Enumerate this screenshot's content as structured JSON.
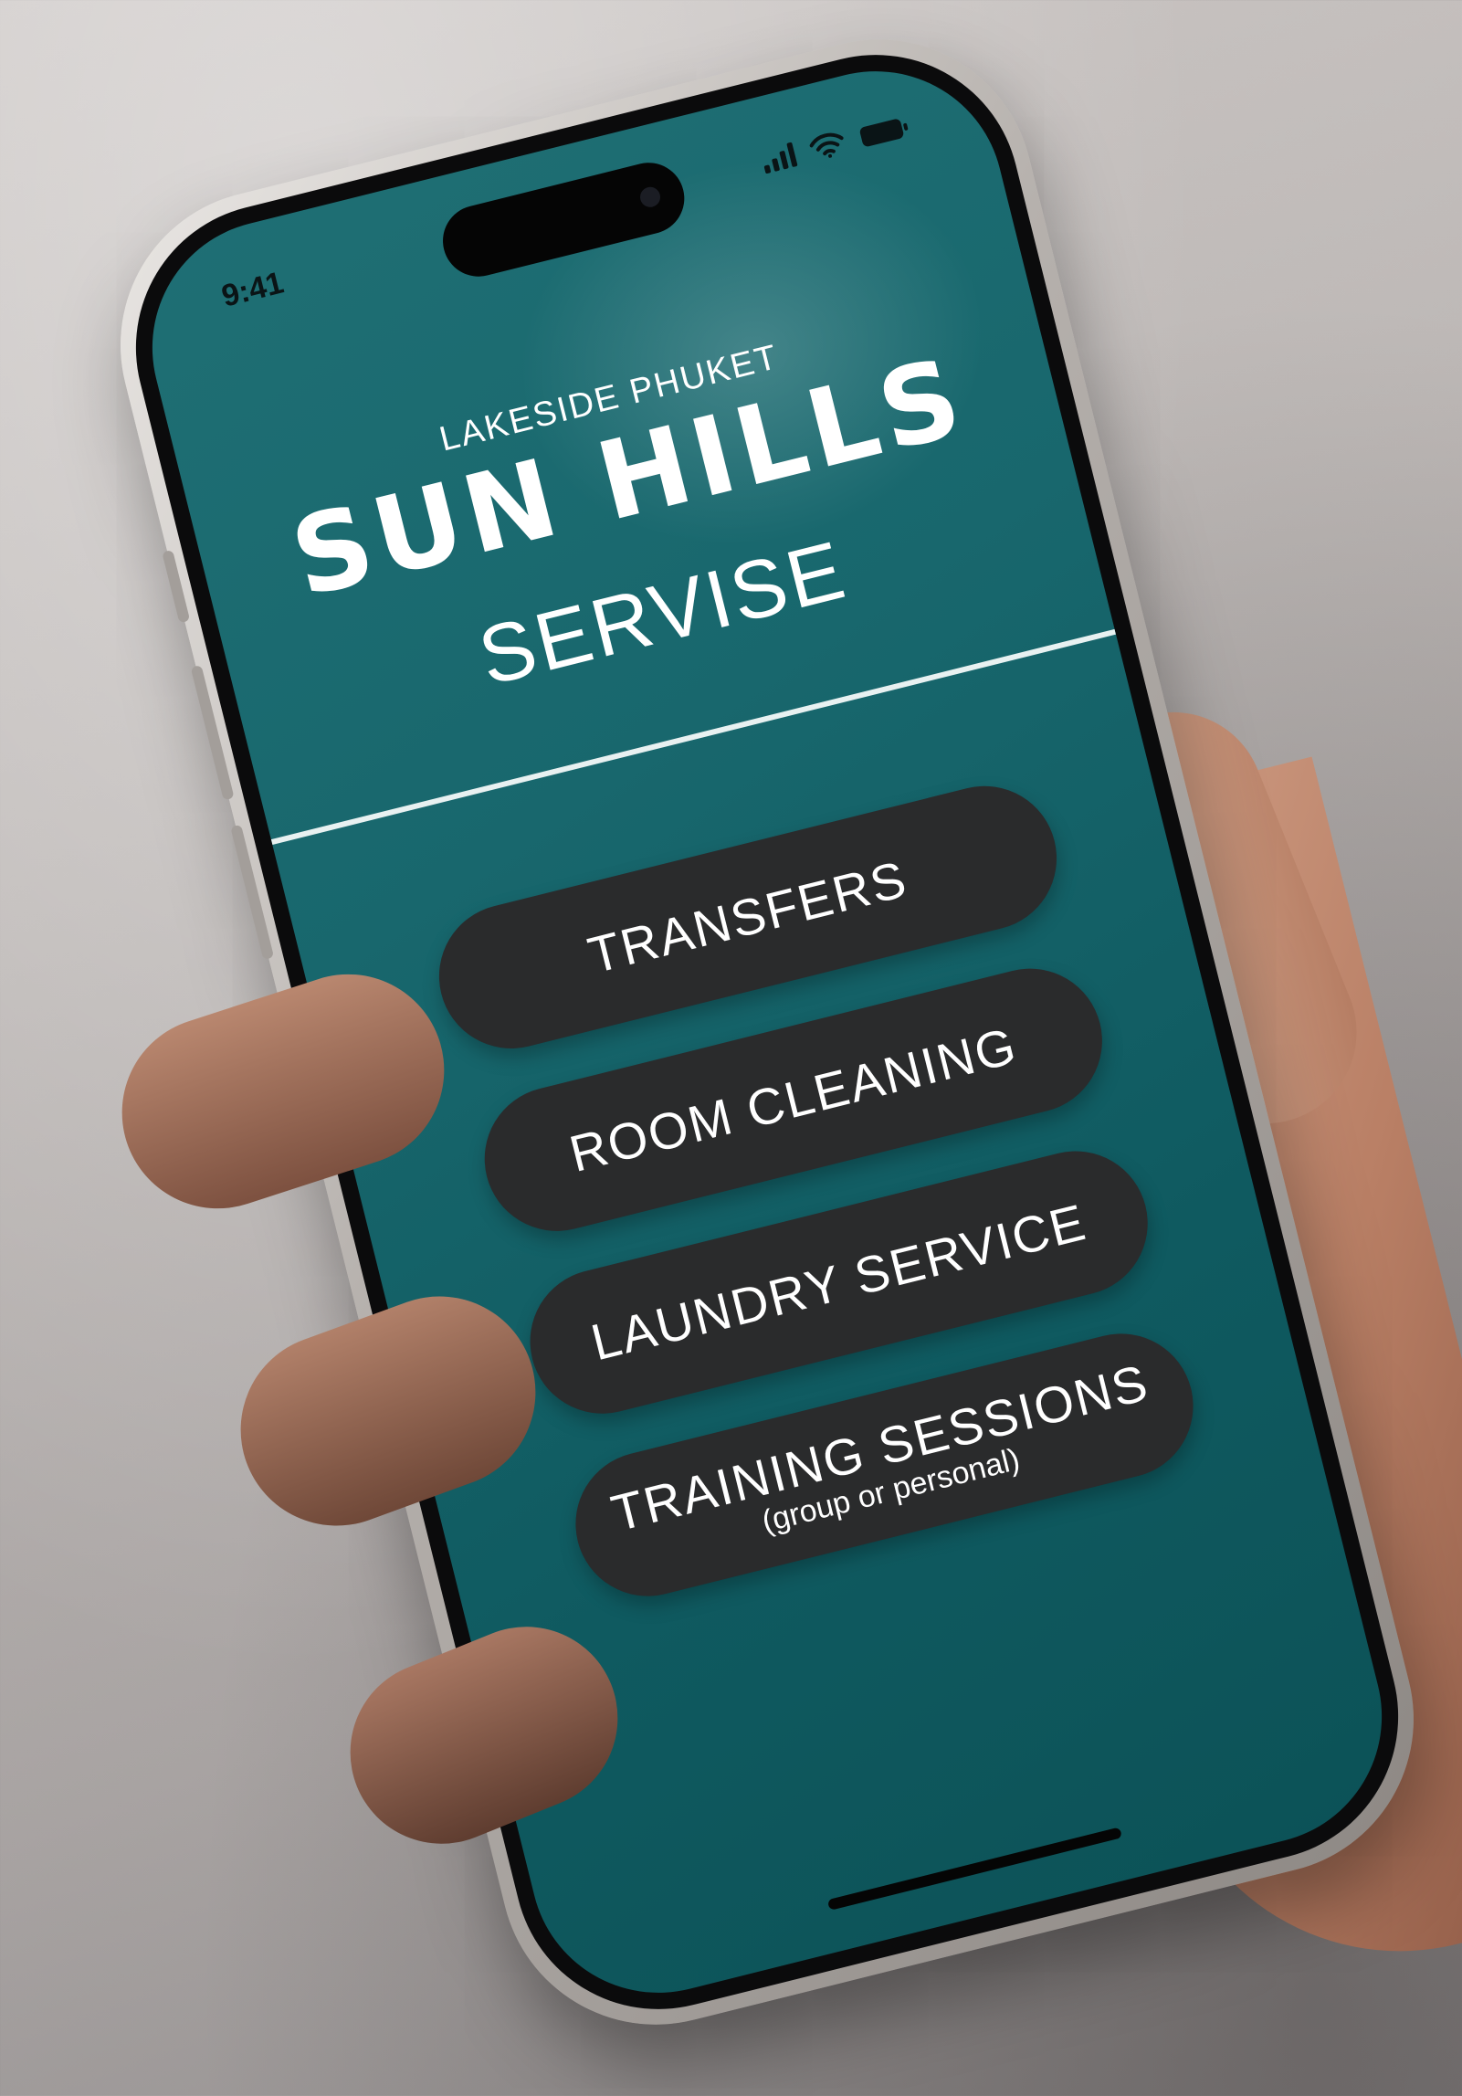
{
  "status_bar": {
    "time": "9:41",
    "icons": [
      "signal-icon",
      "wifi-icon",
      "battery-icon"
    ]
  },
  "brand": {
    "subtitle": "LAKESIDE PHUKET",
    "logo_text": "SUN HILLS"
  },
  "page": {
    "title": "SERVISE"
  },
  "menu": {
    "items": [
      {
        "label": "TRANSFERS",
        "sub": ""
      },
      {
        "label": "ROOM CLEANING",
        "sub": ""
      },
      {
        "label": "LAUNDRY SERVICE",
        "sub": ""
      },
      {
        "label": "TRAINING SESSIONS",
        "sub": "(group or personal)"
      }
    ]
  },
  "colors": {
    "screen_background": "#18676d",
    "button_background": "#2a2b2c",
    "text": "#ffffff"
  }
}
